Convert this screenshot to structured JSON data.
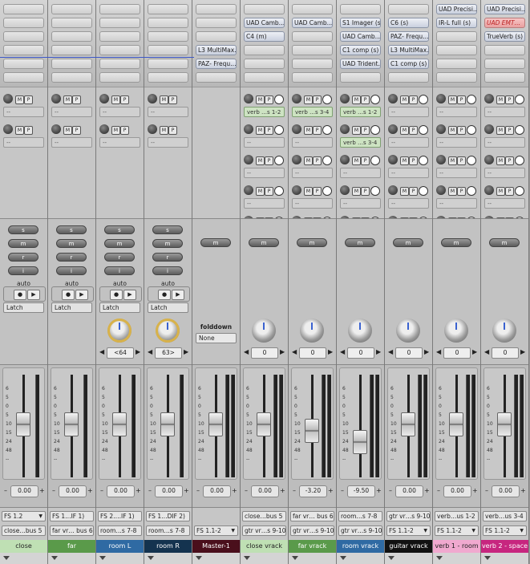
{
  "strips": [
    {
      "name": "close",
      "name_bg": "#bfe0b4",
      "name_fg": "#222",
      "inserts": [
        "",
        "",
        "",
        "",
        ""
      ],
      "sends": [
        "1",
        "2"
      ],
      "send_vals": [
        "",
        ""
      ],
      "has_srmi": true,
      "automation": "Latch",
      "pan": null,
      "pan_gold": false,
      "folddown": false,
      "volume": "0.00",
      "fader_pos": 0.52,
      "meter_pairs": 1,
      "io_in": "FS 1.2",
      "io_out": "close…bus 5"
    },
    {
      "name": "far",
      "name_bg": "#5a9a4a",
      "name_fg": "#fff",
      "inserts": [
        "",
        "",
        "",
        "",
        ""
      ],
      "sends": [
        "1",
        "2"
      ],
      "send_vals": [
        "",
        ""
      ],
      "has_srmi": true,
      "automation": "Latch",
      "pan": null,
      "pan_gold": false,
      "folddown": false,
      "volume": "0.00",
      "fader_pos": 0.52,
      "meter_pairs": 1,
      "io_in": "FS 1…IF 1)",
      "io_out": "far vr… bus 6"
    },
    {
      "name": "room L",
      "name_bg": "#2f6aa3",
      "name_fg": "#fff",
      "inserts": [
        "",
        "",
        "",
        "",
        ""
      ],
      "sends": [
        "1",
        "2"
      ],
      "send_vals": [
        "",
        ""
      ],
      "has_srmi": true,
      "automation": "Latch",
      "pan": "<64",
      "pan_gold": true,
      "folddown": false,
      "volume": "0.00",
      "fader_pos": 0.52,
      "meter_pairs": 1,
      "io_in": "FS 2….IF 1)",
      "io_out": "room…s 7-8"
    },
    {
      "name": "room R",
      "name_bg": "#14334f",
      "name_fg": "#fff",
      "inserts": [
        "",
        "",
        "",
        "",
        ""
      ],
      "sends": [
        "1",
        "2"
      ],
      "send_vals": [
        "",
        ""
      ],
      "has_srmi": true,
      "automation": "Latch",
      "pan": "63>",
      "pan_gold": true,
      "folddown": false,
      "volume": "0.00",
      "fader_pos": 0.52,
      "meter_pairs": 1,
      "io_in": "FS 1…DIF 2)",
      "io_out": "room…s 7-8"
    },
    {
      "name": "Master-1",
      "name_bg": "#4a0f1c",
      "name_fg": "#fff",
      "inserts": [
        "",
        "",
        "",
        "L3 MultiMax…",
        "PAZ- Frequ…"
      ],
      "sends": [],
      "send_vals": [],
      "has_srmi": false,
      "automation": "",
      "pan": null,
      "pan_gold": false,
      "folddown": true,
      "folddown_label": "folddown",
      "folddown_value": "None",
      "volume": "0.00",
      "fader_pos": 0.52,
      "meter_pairs": 2,
      "io_in": "",
      "io_out": "FS 1.1-2"
    },
    {
      "name": "close vrack",
      "name_bg": "#bfe0b4",
      "name_fg": "#222",
      "inserts": [
        "",
        "UAD Camb…",
        "C4 (m)",
        "",
        ""
      ],
      "sends": [
        "1",
        "2",
        "3",
        "4",
        "5"
      ],
      "send_vals": [
        "verb …s 1-2",
        "",
        "",
        "",
        ""
      ],
      "has_srmi": false,
      "automation": "",
      "pan": "0",
      "pan_gold": false,
      "folddown": false,
      "volume": "0.00",
      "fader_pos": 0.52,
      "meter_pairs": 2,
      "io_in": "close…bus 5",
      "io_out": "gtr vr…s 9-10"
    },
    {
      "name": "far vrack",
      "name_bg": "#5a9a4a",
      "name_fg": "#fff",
      "inserts": [
        "",
        "UAD Camb…",
        "",
        "",
        ""
      ],
      "sends": [
        "1",
        "2",
        "3",
        "4",
        "5"
      ],
      "send_vals": [
        "verb …s 3-4",
        "",
        "",
        "",
        ""
      ],
      "has_srmi": false,
      "automation": "",
      "pan": "0",
      "pan_gold": false,
      "folddown": false,
      "volume": "-3.20",
      "fader_pos": 0.44,
      "meter_pairs": 2,
      "io_in": "far vr… bus 6",
      "io_out": "gtr vr…s 9-10"
    },
    {
      "name": "room vrack",
      "name_bg": "#2f6aa3",
      "name_fg": "#fff",
      "inserts": [
        "",
        "S1 Imager (s)",
        "UAD Camb…",
        "C1 comp (s)",
        "UAD Trident…"
      ],
      "sends": [
        "1",
        "2",
        "3",
        "4",
        "5"
      ],
      "send_vals": [
        "verb …s 1-2",
        "verb …s 3-4",
        "",
        "",
        ""
      ],
      "has_srmi": false,
      "automation": "",
      "pan": "0",
      "pan_gold": false,
      "folddown": false,
      "volume": "-9.50",
      "fader_pos": 0.3,
      "meter_pairs": 2,
      "io_in": "room…s 7-8",
      "io_out": "gtr vr…s 9-10"
    },
    {
      "name": "guitar vrack",
      "name_bg": "#111111",
      "name_fg": "#fff",
      "inserts": [
        "",
        "C6 (s)",
        "PAZ- Frequ…",
        "L3 MultiMax…",
        "C1 comp (s)"
      ],
      "sends": [
        "1",
        "2",
        "3",
        "4",
        "5"
      ],
      "send_vals": [
        "",
        "",
        "",
        "",
        ""
      ],
      "has_srmi": false,
      "automation": "",
      "pan": "0",
      "pan_gold": false,
      "folddown": false,
      "volume": "0.00",
      "fader_pos": 0.52,
      "meter_pairs": 2,
      "io_in": "gtr vr…s 9-10",
      "io_out": "FS 1.1-2"
    },
    {
      "name": "verb 1 - room",
      "name_bg": "#f0a9cf",
      "name_fg": "#222",
      "inserts": [
        "UAD Precisi…",
        "IR-L full (s)",
        "",
        "",
        ""
      ],
      "sends": [
        "1",
        "2",
        "3",
        "4",
        "5"
      ],
      "send_vals": [
        "",
        "",
        "",
        "",
        ""
      ],
      "has_srmi": false,
      "automation": "",
      "pan": "0",
      "pan_gold": false,
      "folddown": false,
      "volume": "0.00",
      "fader_pos": 0.52,
      "meter_pairs": 2,
      "io_in": "verb…us 1-2",
      "io_out": "FS 1.1-2"
    },
    {
      "name": "verb 2 - space",
      "name_bg": "#c7267f",
      "name_fg": "#fff",
      "inserts": [
        "UAD Precisi…",
        "UAD EMT…",
        "TrueVerb (s)",
        "",
        ""
      ],
      "sends": [
        "1",
        "2",
        "3",
        "4",
        "5"
      ],
      "send_vals": [
        "",
        "",
        "",
        "",
        ""
      ],
      "has_srmi": false,
      "automation": "",
      "pan": "0",
      "pan_gold": false,
      "folddown": false,
      "volume": "0.00",
      "fader_pos": 0.52,
      "meter_pairs": 2,
      "io_in": "verb…us 3-4",
      "io_out": "FS 1.1-2"
    }
  ],
  "labels": {
    "solo": "s",
    "mute": "m",
    "rec": "r",
    "input": "i",
    "auto": "auto",
    "send_m": "M",
    "send_p": "P",
    "send_empty": "--",
    "minus": "–",
    "plus": "+",
    "rec_glyph": "●",
    "play_glyph": "▶",
    "pan_left": "◀",
    "pan_right": "▶",
    "dropdown": "▼"
  },
  "scale_marks": [
    "6",
    "5",
    "0",
    "5",
    "10",
    "15",
    "24",
    "48",
    "--"
  ],
  "colors": {
    "blue_line": "#3d58c8",
    "red_insert": "#e9a0a0"
  }
}
